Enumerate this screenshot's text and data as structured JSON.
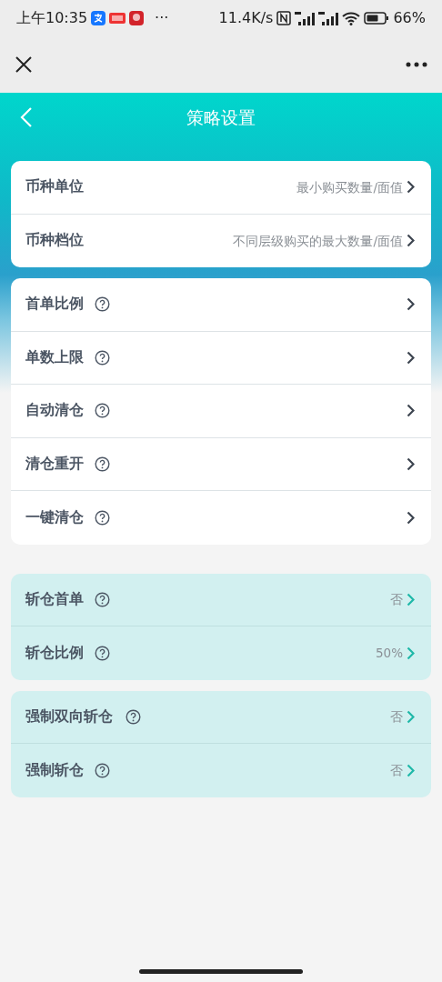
{
  "status_bar": {
    "time": "上午10:35",
    "more": "···",
    "network_speed": "11.4K/s",
    "battery": "66%"
  },
  "title": "策略设置",
  "groups": [
    {
      "kind": "plain",
      "items": [
        {
          "label": "币种单位",
          "help": false,
          "value": "最小购买数量/面值"
        },
        {
          "label": "币种档位",
          "help": false,
          "value": "不同层级购买的最大数量/面值"
        }
      ]
    },
    {
      "kind": "plain",
      "items": [
        {
          "label": "首单比例",
          "help": true
        },
        {
          "label": "单数上限",
          "help": true
        },
        {
          "label": "自动清仓",
          "help": true
        },
        {
          "label": "清仓重开",
          "help": true
        },
        {
          "label": "一键清仓",
          "help": true
        }
      ]
    },
    {
      "kind": "highlight",
      "items": [
        {
          "label": "斩仓首单",
          "help": true,
          "value": "否"
        },
        {
          "label": "斩仓比例",
          "help": true,
          "value": "50%"
        }
      ]
    },
    {
      "kind": "highlight",
      "items": [
        {
          "label": "强制双向斩仓",
          "help": true,
          "value": "否"
        },
        {
          "label": "强制斩仓",
          "help": true,
          "value": "否"
        }
      ]
    }
  ]
}
